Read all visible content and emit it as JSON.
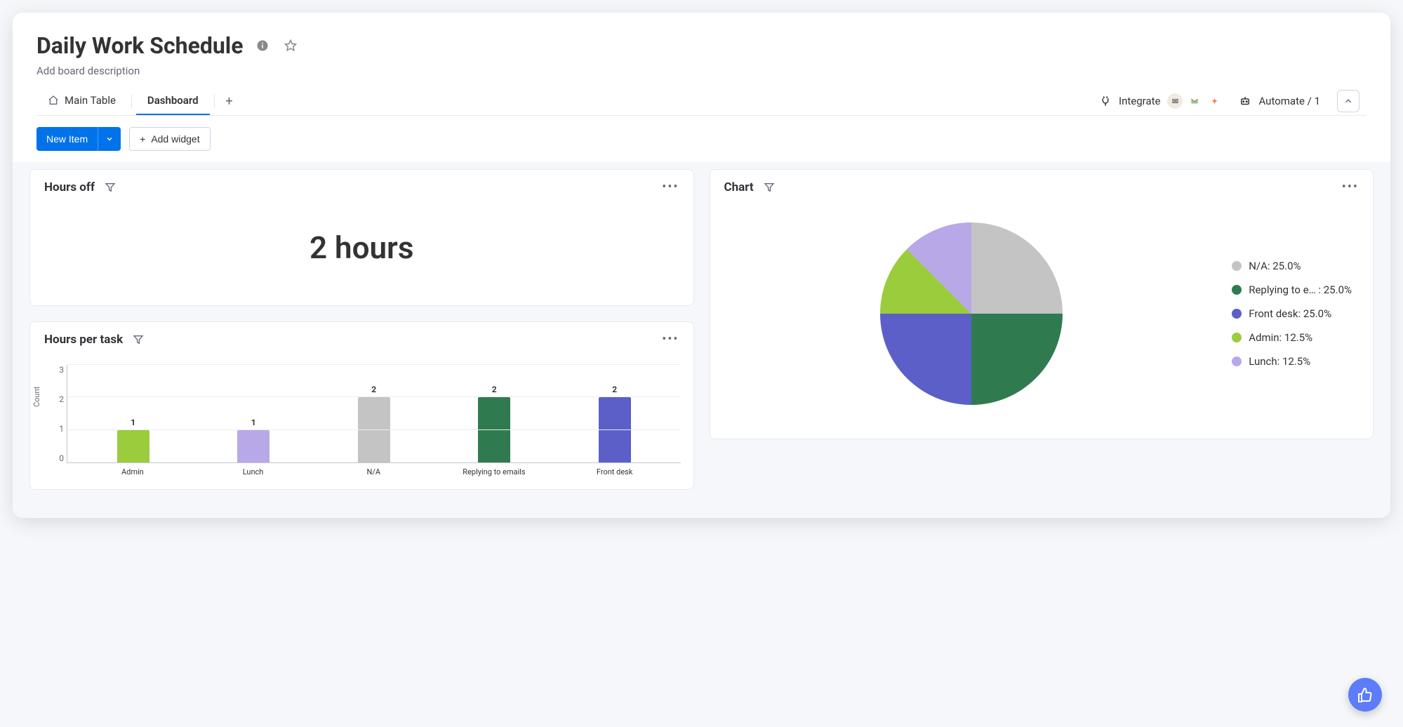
{
  "header": {
    "title": "Daily Work Schedule",
    "description": "Add board description"
  },
  "tabs": {
    "items": [
      {
        "label": "Main Table",
        "active": false
      },
      {
        "label": "Dashboard",
        "active": true
      }
    ]
  },
  "actions": {
    "integrate_label": "Integrate",
    "automate_label": "Automate / 1"
  },
  "toolbar": {
    "new_item_label": "New Item",
    "add_widget_label": "Add widget"
  },
  "widgets": {
    "hours_off": {
      "title": "Hours off",
      "value": "2 hours"
    },
    "hours_per_task": {
      "title": "Hours per task"
    },
    "chart": {
      "title": "Chart",
      "legend": [
        {
          "label": "N/A: 25.0%",
          "color": "#c4c4c4"
        },
        {
          "label": "Replying to e… : 25.0%",
          "color": "#2f7b4f"
        },
        {
          "label": "Front desk: 25.0%",
          "color": "#5b5fc7"
        },
        {
          "label": "Admin: 12.5%",
          "color": "#9bcc3c"
        },
        {
          "label": "Lunch: 12.5%",
          "color": "#b9a8e8"
        }
      ]
    }
  },
  "chart_data": [
    {
      "id": "hours_per_task_bar",
      "type": "bar",
      "title": "Hours per task",
      "ylabel": "Count",
      "xlabel": "",
      "ylim": [
        0,
        3
      ],
      "yticks": [
        0,
        1,
        2,
        3
      ],
      "categories": [
        "Admin",
        "Lunch",
        "N/A",
        "Replying to emails",
        "Front desk"
      ],
      "values": [
        1,
        1,
        2,
        2,
        2
      ],
      "colors": [
        "#9bcc3c",
        "#b9a8e8",
        "#c4c4c4",
        "#2f7b4f",
        "#5b5fc7"
      ]
    },
    {
      "id": "task_distribution_pie",
      "type": "pie",
      "title": "Chart",
      "series": [
        {
          "name": "N/A",
          "value": 25.0,
          "color": "#c4c4c4"
        },
        {
          "name": "Replying to emails",
          "value": 25.0,
          "color": "#2f7b4f"
        },
        {
          "name": "Front desk",
          "value": 25.0,
          "color": "#5b5fc7"
        },
        {
          "name": "Admin",
          "value": 12.5,
          "color": "#9bcc3c"
        },
        {
          "name": "Lunch",
          "value": 12.5,
          "color": "#b9a8e8"
        }
      ]
    }
  ]
}
